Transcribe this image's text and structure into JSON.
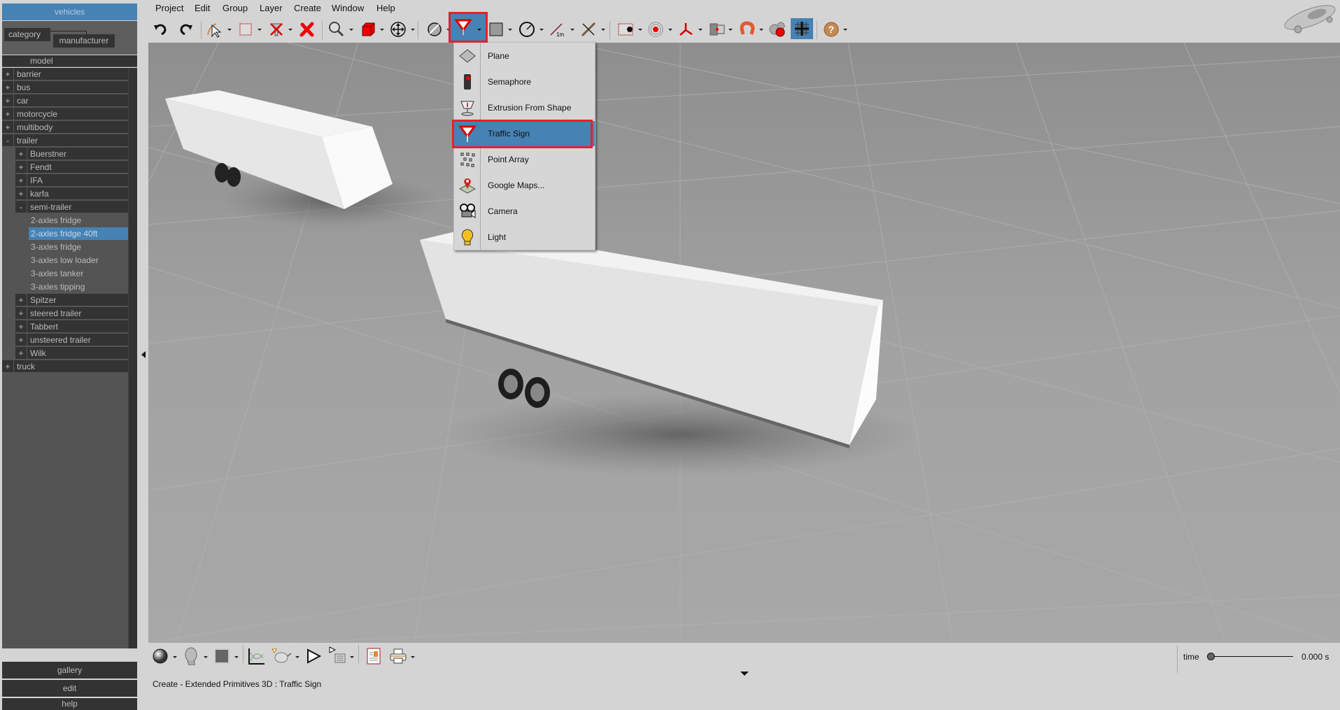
{
  "library": {
    "title": "vehicles",
    "facets": [
      "category",
      "manufacturer"
    ],
    "column_header": "model",
    "tree": [
      {
        "toggle": "+",
        "label": "barrier",
        "level": 0
      },
      {
        "toggle": "+",
        "label": "bus",
        "level": 0
      },
      {
        "toggle": "+",
        "label": "car",
        "level": 0
      },
      {
        "toggle": "+",
        "label": "motorcycle",
        "level": 0
      },
      {
        "toggle": "+",
        "label": "multibody",
        "level": 0
      },
      {
        "toggle": "-",
        "label": "trailer",
        "level": 0
      },
      {
        "toggle": "+",
        "label": "Buerstner",
        "level": 1
      },
      {
        "toggle": "+",
        "label": "Fendt",
        "level": 1
      },
      {
        "toggle": "+",
        "label": "IFA",
        "level": 1
      },
      {
        "toggle": "+",
        "label": "karfa",
        "level": 1
      },
      {
        "toggle": "-",
        "label": "semi-trailer",
        "level": 1
      },
      {
        "toggle": "",
        "label": "2-axles fridge",
        "level": 2
      },
      {
        "toggle": "",
        "label": "2-axles fridge 40ft",
        "level": 2,
        "selected": true
      },
      {
        "toggle": "",
        "label": "3-axles fridge",
        "level": 2
      },
      {
        "toggle": "",
        "label": "3-axles low loader",
        "level": 2
      },
      {
        "toggle": "",
        "label": "3-axles tanker",
        "level": 2
      },
      {
        "toggle": "",
        "label": "3-axles tipping",
        "level": 2
      },
      {
        "toggle": "+",
        "label": "Spitzer",
        "level": 1
      },
      {
        "toggle": "+",
        "label": "steered trailer",
        "level": 1
      },
      {
        "toggle": "+",
        "label": "Tabbert",
        "level": 1
      },
      {
        "toggle": "+",
        "label": "unsteered trailer",
        "level": 1
      },
      {
        "toggle": "+",
        "label": "Wilk",
        "level": 1
      },
      {
        "toggle": "+",
        "label": "truck",
        "level": 0
      }
    ],
    "bottom_buttons": [
      "gallery",
      "edit",
      "help"
    ]
  },
  "menubar": [
    "Project",
    "Edit",
    "Group",
    "Layer",
    "Create",
    "Window",
    "Help"
  ],
  "toolbar": [
    {
      "icon": "undo-icon"
    },
    {
      "icon": "redo-icon"
    },
    {
      "icon": "select-arrow-icon",
      "dropdown": true
    },
    {
      "icon": "selection-rectangle-icon",
      "dropdown": true
    },
    {
      "icon": "filter-icon",
      "dropdown": true
    },
    {
      "icon": "delete-icon"
    },
    {
      "icon": "zoom-icon",
      "dropdown": true
    },
    {
      "icon": "cube-icon",
      "dropdown": true
    },
    {
      "icon": "move-icon",
      "dropdown": true
    },
    {
      "icon": "sphere-slash-icon",
      "dropdown": true
    },
    {
      "icon": "traffic-sign-icon",
      "dropdown": true,
      "active": true
    },
    {
      "icon": "plane-square-icon",
      "dropdown": true
    },
    {
      "icon": "circle-radius-icon",
      "dropdown": true
    },
    {
      "icon": "measure-1m-icon",
      "dropdown": true
    },
    {
      "icon": "snap-icon",
      "dropdown": true
    },
    {
      "icon": "camera-frame-icon",
      "dropdown": true
    },
    {
      "icon": "target-icon",
      "dropdown": true
    },
    {
      "icon": "axes-icon",
      "dropdown": true
    },
    {
      "icon": "mirror-icon",
      "dropdown": true
    },
    {
      "icon": "magnet-icon",
      "dropdown": true
    },
    {
      "icon": "gears-record-icon"
    },
    {
      "icon": "grid-icon",
      "active": true
    },
    {
      "icon": "help-icon",
      "dropdown": true
    }
  ],
  "create_menu": {
    "items": [
      {
        "label": "Plane",
        "icon": "plane-icon"
      },
      {
        "label": "Semaphore",
        "icon": "semaphore-icon"
      },
      {
        "label": "Extrusion From Shape",
        "icon": "extrusion-icon"
      },
      {
        "label": "Traffic Sign",
        "icon": "traffic-sign-icon",
        "highlighted": true
      },
      {
        "label": "Point Array",
        "icon": "point-array-icon"
      },
      {
        "label": "Google Maps...",
        "icon": "google-maps-icon"
      },
      {
        "label": "Camera",
        "icon": "camera-icon"
      },
      {
        "label": "Light",
        "icon": "light-icon"
      }
    ]
  },
  "bottom_toolbar": [
    {
      "icon": "material-sphere-icon",
      "dropdown": true
    },
    {
      "icon": "head-icon",
      "dropdown": true
    },
    {
      "icon": "color-swatch-icon",
      "dropdown": true
    },
    {
      "icon": "graph-icon"
    },
    {
      "icon": "teapot-icon",
      "dropdown": true
    },
    {
      "icon": "play-icon"
    },
    {
      "icon": "play-list-icon",
      "dropdown": true
    },
    {
      "icon": "report-icon"
    },
    {
      "icon": "print-icon",
      "dropdown": true
    }
  ],
  "status": "Create - Extended Primitives 3D : Traffic Sign",
  "time": {
    "label": "time",
    "value": "0.000 s",
    "position": 0
  },
  "colors": {
    "accent": "#4682b4",
    "highlight_border": "#e8202a",
    "panel_dark": "#333333"
  }
}
